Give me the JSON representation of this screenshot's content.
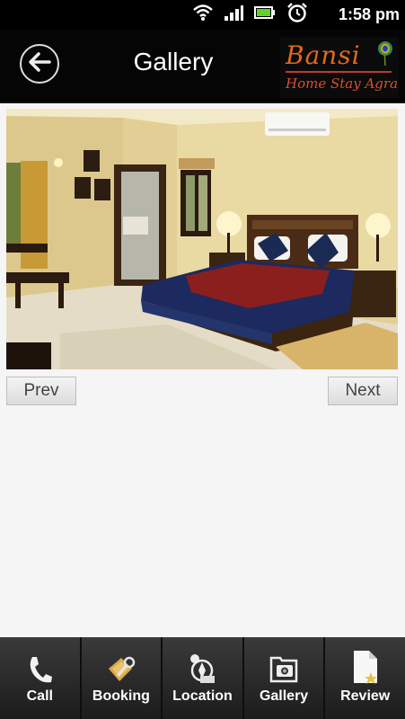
{
  "status": {
    "time": "1:58 pm"
  },
  "header": {
    "title": "Gallery",
    "logo_brand": "Bansi",
    "logo_tagline": "Home Stay Agra"
  },
  "gallery": {
    "prev_label": "Prev",
    "next_label": "Next"
  },
  "tabs": [
    {
      "label": "Call",
      "icon": "phone-icon"
    },
    {
      "label": "Booking",
      "icon": "booking-icon"
    },
    {
      "label": "Location",
      "icon": "location-icon"
    },
    {
      "label": "Gallery",
      "icon": "camera-icon"
    },
    {
      "label": "Review",
      "icon": "review-icon"
    }
  ]
}
